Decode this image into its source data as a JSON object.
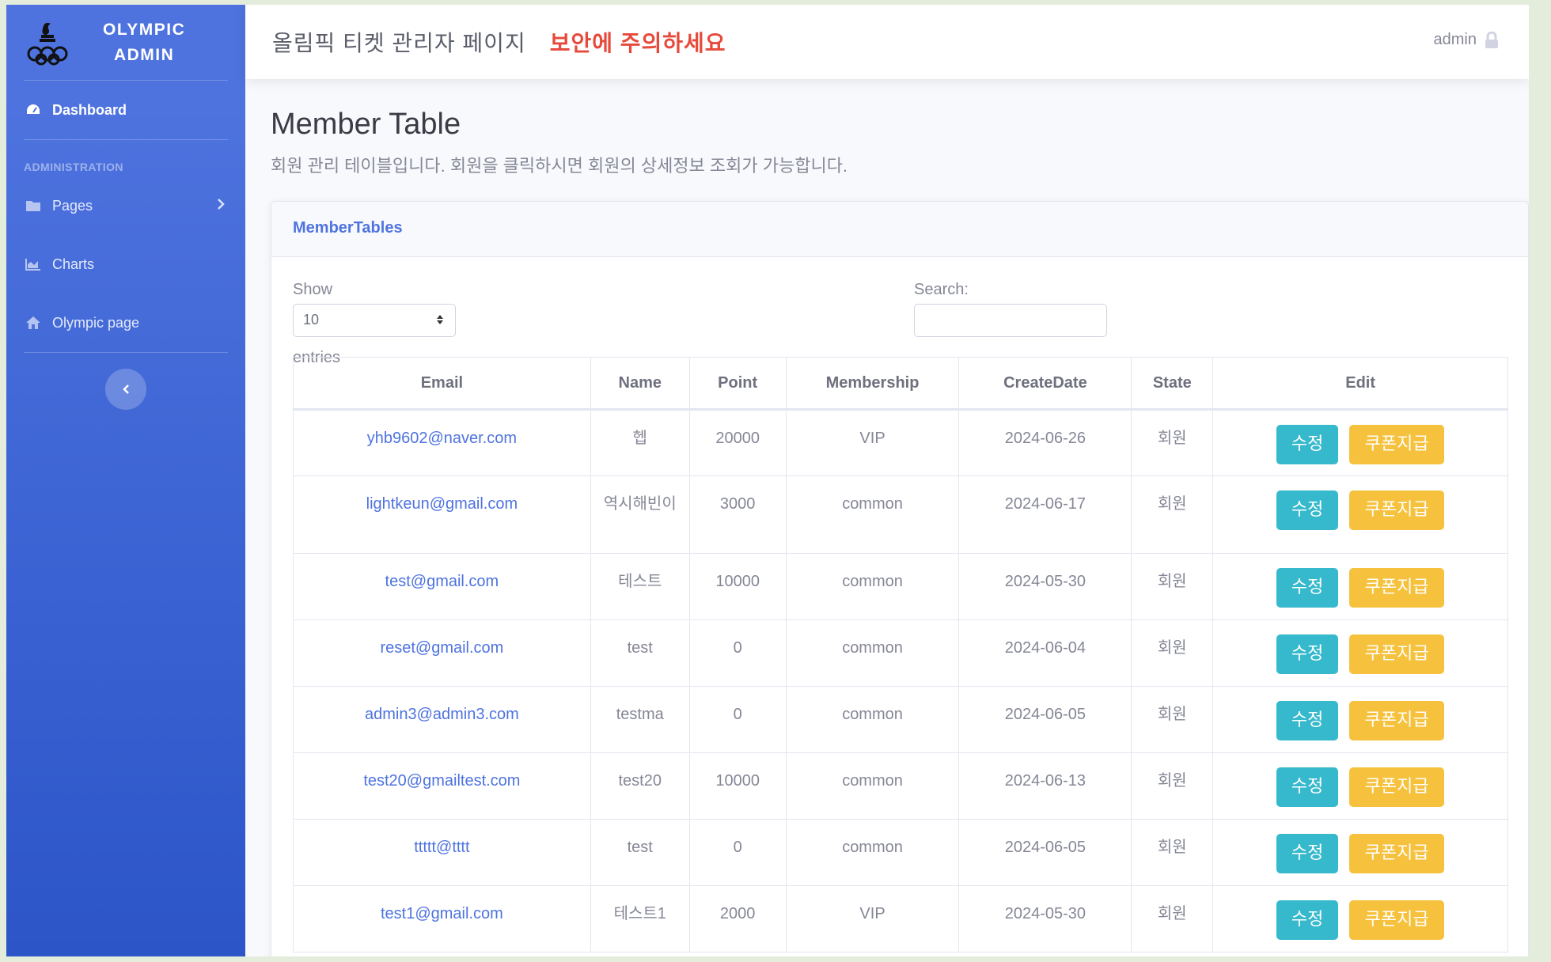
{
  "brand": {
    "line1": "OLYMPIC",
    "line2": "ADMIN"
  },
  "sidebar": {
    "dashboard": "Dashboard",
    "heading": "ADMINISTRATION",
    "items": [
      {
        "label": "Pages",
        "icon": "folder-icon"
      },
      {
        "label": "Charts",
        "icon": "area-chart-icon"
      },
      {
        "label": "Olympic page",
        "icon": "home-icon"
      }
    ]
  },
  "topbar": {
    "title": "올림픽 티켓 관리자 페이지",
    "warning": "보안에 주의하세요",
    "user": "admin"
  },
  "page": {
    "title": "Member Table",
    "description": "회원 관리 테이블입니다. 회원을 클릭하시면 회원의 상세정보 조회가 가능합니다."
  },
  "card": {
    "title": "MemberTables",
    "show_label": "Show",
    "entries_value": "10",
    "entries_label": "entries",
    "search_label": "Search:"
  },
  "table": {
    "columns": [
      "Email",
      "Name",
      "Point",
      "Membership",
      "CreateDate",
      "State",
      "Edit"
    ],
    "edit_label": "수정",
    "coupon_label": "쿠폰지급",
    "rows": [
      {
        "email": "yhb9602@naver.com",
        "name": "헵",
        "point": "20000",
        "membership": "VIP",
        "date": "2024-06-26",
        "state": "회원"
      },
      {
        "email": "lightkeun@gmail.com",
        "name": "역시해빈이",
        "point": "3000",
        "membership": "common",
        "date": "2024-06-17",
        "state": "회원"
      },
      {
        "email": "test@gmail.com",
        "name": "테스트",
        "point": "10000",
        "membership": "common",
        "date": "2024-05-30",
        "state": "회원"
      },
      {
        "email": "reset@gmail.com",
        "name": "test",
        "point": "0",
        "membership": "common",
        "date": "2024-06-04",
        "state": "회원"
      },
      {
        "email": "admin3@admin3.com",
        "name": "testma",
        "point": "0",
        "membership": "common",
        "date": "2024-06-05",
        "state": "회원"
      },
      {
        "email": "test20@gmailtest.com",
        "name": "test20",
        "point": "10000",
        "membership": "common",
        "date": "2024-06-13",
        "state": "회원"
      },
      {
        "email": "ttttt@tttt",
        "name": "test",
        "point": "0",
        "membership": "common",
        "date": "2024-06-05",
        "state": "회원"
      },
      {
        "email": "test1@gmail.com",
        "name": "테스트1",
        "point": "2000",
        "membership": "VIP",
        "date": "2024-05-30",
        "state": "회원"
      }
    ]
  },
  "colors": {
    "primary": "#4e73df",
    "danger": "#e74a3b",
    "info": "#36b9cc",
    "warning": "#f6c23e"
  }
}
